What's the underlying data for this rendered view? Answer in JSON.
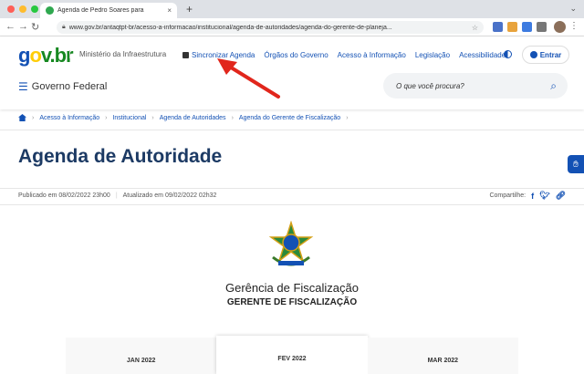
{
  "browser": {
    "tab_title": "Agenda de Pedro Soares para",
    "tab_close": "×",
    "new_tab": "+",
    "url": "www.gov.br/antaqtpt-br/acesso-a-informacao/institucional/agenda-de-autoridades/agenda-do-gerente-de-planeja...",
    "colors": {
      "close": "#ff5f57",
      "minimize": "#febc2e",
      "maximize": "#28c840"
    }
  },
  "header": {
    "logo_parts": [
      "g",
      "o",
      "v.br"
    ],
    "ministry": "Ministério da Infraestrutura",
    "links": {
      "sync": "Sincronizar Agenda",
      "orgaos": "Órgãos do Governo",
      "acesso": "Acesso à Informação",
      "legislacao": "Legislação",
      "acessibilidade": "Acessibilidade"
    },
    "login": "Entrar",
    "menu": "Governo Federal",
    "search_placeholder": "O que você procura?"
  },
  "breadcrumb": [
    "Acesso à Informação",
    "Institucional",
    "Agenda de Autoridades",
    "Agenda do Gerente de Fiscalização"
  ],
  "page": {
    "title": "Agenda de Autoridade",
    "published": "Publicado em 08/02/2022 23h00",
    "updated": "Atualizado em 09/02/2022 02h32",
    "share": "Compartilhe:",
    "unit": "Gerência de Fiscalização",
    "role": "GERENTE DE FISCALIZAÇÃO"
  },
  "months": [
    "JAN 2022",
    "FEV 2022",
    "MAR 2022"
  ],
  "colors": {
    "brand_blue": "#1351b4",
    "title_navy": "#1c3a64",
    "arrow_red": "#e1261c"
  }
}
